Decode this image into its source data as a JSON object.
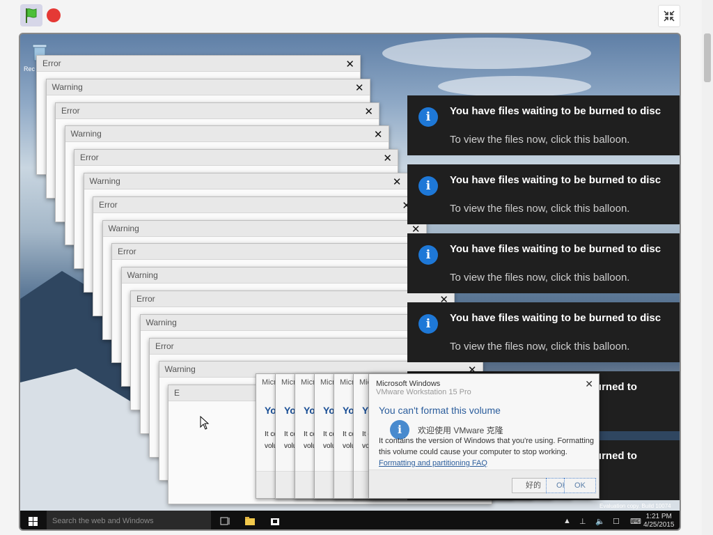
{
  "desktop": {
    "recycle_label": "Rec"
  },
  "error_dialogs": [
    {
      "title": "Error"
    },
    {
      "title": "Warning"
    },
    {
      "title": "Error"
    },
    {
      "title": "Warning"
    },
    {
      "title": "Error"
    },
    {
      "title": "Warning"
    },
    {
      "title": "Error"
    },
    {
      "title": "Warning"
    },
    {
      "title": "Error"
    },
    {
      "title": "Warning"
    },
    {
      "title": "Error"
    },
    {
      "title": "Warning"
    },
    {
      "title": "Error"
    },
    {
      "title": "Warning"
    },
    {
      "title": "E"
    }
  ],
  "balloons": [
    {
      "title": "You have files waiting to be burned to disc",
      "subtitle": "To view the files now, click this balloon."
    },
    {
      "title": "You have files waiting to be burned to disc",
      "subtitle": "To view the files now, click this balloon."
    },
    {
      "title": "You have files waiting to be burned to disc",
      "subtitle": "To view the files now, click this balloon."
    },
    {
      "title": "You have files waiting to be burned to disc",
      "subtitle": "To view the files now, click this balloon."
    },
    {
      "title": "You have files waiting to be burned to",
      "subtitle": "s balloon."
    },
    {
      "title": "You have files waiting to be burned to",
      "subtitle": "s balloon."
    }
  ],
  "ms_dialog": {
    "title": "Microsoft Windows",
    "title_behind": "VMware Workstation 15 Pro",
    "heading": "You can't format this volume",
    "chinese_text": "欢迎使用 VMware 克隆",
    "body": "It contains the version of Windows that you're using. Formatting this volume could cause your computer to stop working.",
    "link": "Formatting and partitioning FAQ",
    "btn_cn": "好的",
    "btn_ok": "OK",
    "btn_ok2": "OK"
  },
  "watermark": "Evaluation copy. Build 10074",
  "taskbar": {
    "search_placeholder": "Search the web and Windows",
    "time": "1:21 PM",
    "date": "4/25/2015"
  }
}
